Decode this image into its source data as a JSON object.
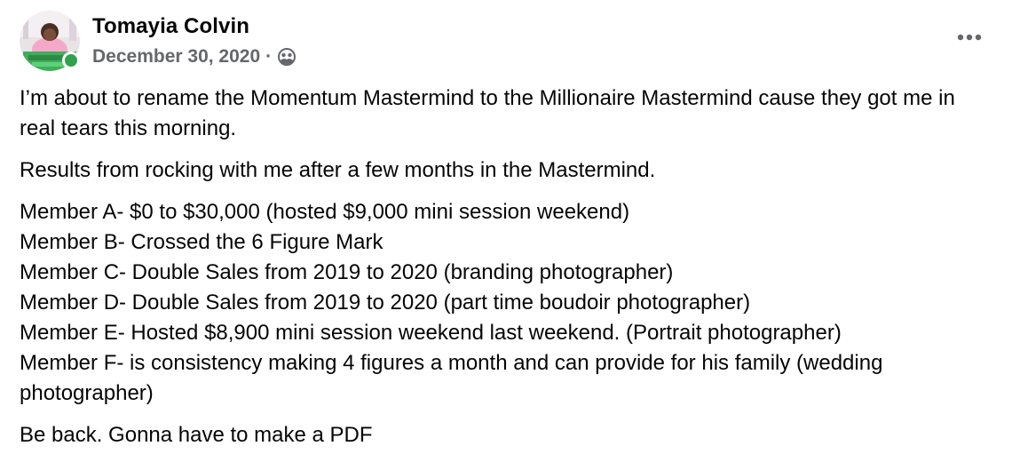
{
  "post": {
    "author": "Tomayia Colvin",
    "date": "December 30, 2020",
    "separator": "·",
    "audience_icon": "friends-icon",
    "more_icon": "more-options-icon",
    "online_status_color": "#31a24c",
    "paragraphs": [
      {
        "lines": [
          "I’m about to rename the Momentum Mastermind to the Millionaire Mastermind cause they got me in real tears this morning."
        ]
      },
      {
        "lines": [
          "Results from rocking with me after a few months in the Mastermind."
        ]
      },
      {
        "lines": [
          "Member A- $0 to $30,000 (hosted $9,000 mini session weekend)",
          "Member B- Crossed the 6 Figure Mark",
          "Member C- Double Sales from 2019 to 2020 (branding photographer)",
          "Member D- Double Sales from 2019 to 2020 (part time boudoir photographer)",
          "Member E- Hosted $8,900 mini session weekend last weekend. (Portrait photographer)",
          "Member F- is consistency making 4 figures a month and can provide for his family (wedding photographer)"
        ]
      },
      {
        "lines": [
          "Be back. Gonna have to make a PDF"
        ]
      }
    ]
  }
}
